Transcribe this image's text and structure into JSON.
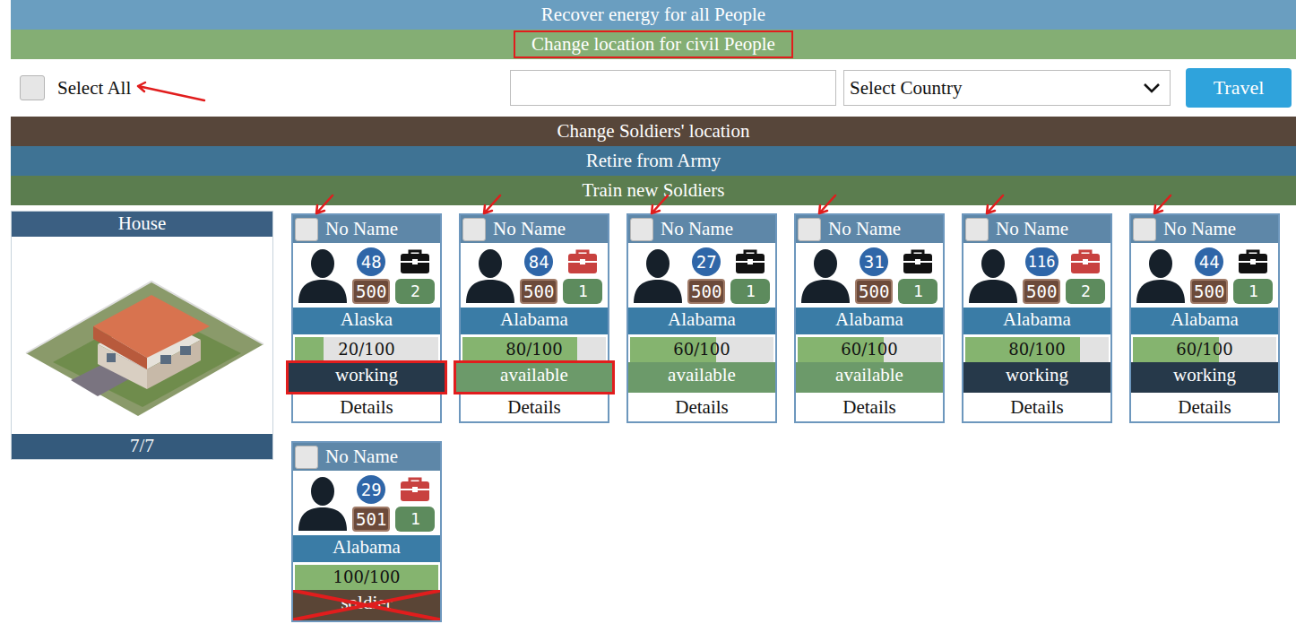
{
  "sections_top": [
    {
      "label": "Recover energy for all People",
      "color": "#6a9ec0",
      "highlighted": false
    },
    {
      "label": "Change location for civil People",
      "color": "#84ae74",
      "highlighted": true
    }
  ],
  "travel_panel": {
    "select_all": {
      "label": "Select All",
      "checked": false,
      "annotated": true
    },
    "search": {
      "value": ""
    },
    "country": {
      "value": "Select Country"
    },
    "button": "Travel"
  },
  "sections_bottom": [
    {
      "label": "Change Soldiers' location",
      "color": "#57463a",
      "highlighted": false
    },
    {
      "label": "Retire from Army",
      "color": "#3f7394",
      "highlighted": false
    },
    {
      "label": "Train new Soldiers",
      "color": "#5b7d4f",
      "highlighted": false
    }
  ],
  "house": {
    "title": "House",
    "count": "7/7"
  },
  "people": [
    {
      "name": "No Name",
      "checked": false,
      "annotated": true,
      "level": "48",
      "bag": {
        "color": "#111111"
      },
      "money": "500",
      "skill": "2",
      "location": "Alaska",
      "energy": {
        "reading": "20/100",
        "level": 0.2
      },
      "status": {
        "label": "working",
        "color": "#26394a",
        "highlighted": true,
        "crossed": false
      },
      "details": "Details"
    },
    {
      "name": "No Name",
      "checked": false,
      "annotated": true,
      "level": "84",
      "bag": {
        "color": "#c8413f"
      },
      "money": "500",
      "skill": "1",
      "location": "Alabama",
      "energy": {
        "reading": "80/100",
        "level": 0.8
      },
      "status": {
        "label": "available",
        "color": "#6c9a6a",
        "highlighted": true,
        "crossed": false
      },
      "details": "Details"
    },
    {
      "name": "No Name",
      "checked": false,
      "annotated": true,
      "level": "27",
      "bag": {
        "color": "#111111"
      },
      "money": "500",
      "skill": "1",
      "location": "Alabama",
      "energy": {
        "reading": "60/100",
        "level": 0.6
      },
      "status": {
        "label": "available",
        "color": "#6c9a6a",
        "highlighted": false,
        "crossed": false
      },
      "details": "Details"
    },
    {
      "name": "No Name",
      "checked": false,
      "annotated": true,
      "level": "31",
      "bag": {
        "color": "#111111"
      },
      "money": "500",
      "skill": "1",
      "location": "Alabama",
      "energy": {
        "reading": "60/100",
        "level": 0.6
      },
      "status": {
        "label": "available",
        "color": "#6c9a6a",
        "highlighted": false,
        "crossed": false
      },
      "details": "Details"
    },
    {
      "name": "No Name",
      "checked": false,
      "annotated": true,
      "level": "116",
      "bag": {
        "color": "#c8413f"
      },
      "money": "500",
      "skill": "2",
      "location": "Alabama",
      "energy": {
        "reading": "80/100",
        "level": 0.8
      },
      "status": {
        "label": "working",
        "color": "#26394a",
        "highlighted": false,
        "crossed": false
      },
      "details": "Details"
    },
    {
      "name": "No Name",
      "checked": false,
      "annotated": true,
      "level": "44",
      "bag": {
        "color": "#111111"
      },
      "money": "500",
      "skill": "1",
      "location": "Alabama",
      "energy": {
        "reading": "60/100",
        "level": 0.6
      },
      "status": {
        "label": "working",
        "color": "#26394a",
        "highlighted": false,
        "crossed": false
      },
      "details": "Details"
    },
    {
      "name": "No Name",
      "checked": false,
      "annotated": false,
      "level": "29",
      "bag": {
        "color": "#c8413f"
      },
      "money": "501",
      "skill": "1",
      "location": "Alabama",
      "energy": {
        "reading": "100/100",
        "level": 1
      },
      "status": {
        "label": "soldier",
        "color": "#5a4536",
        "highlighted": false,
        "crossed": true
      },
      "details": null
    }
  ]
}
